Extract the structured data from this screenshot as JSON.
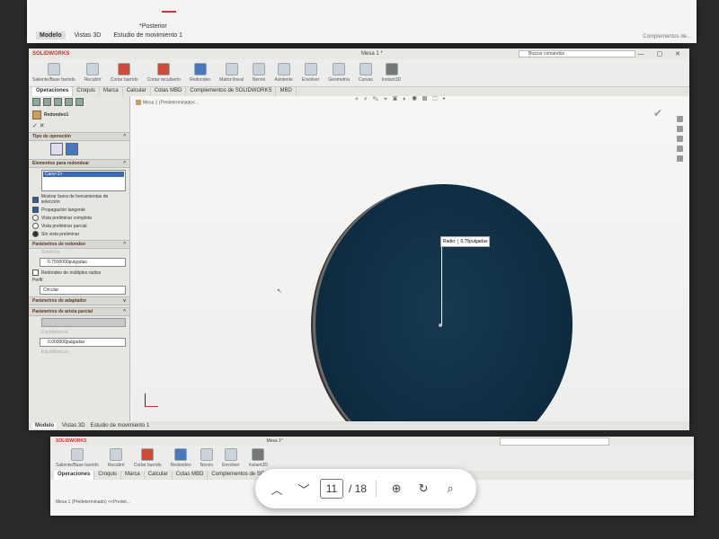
{
  "top_page": {
    "label": "*Posterior",
    "tabs": [
      "Modelo",
      "Vistas 3D",
      "Estudio de movimiento 1"
    ],
    "right_text": "Complementos de..."
  },
  "window": {
    "app": "SOLIDWORKS",
    "title": "Mesa 1 *",
    "search_placeholder": "Buscar comandos",
    "controls": "— ▢ ✕"
  },
  "ribbon": {
    "groups": [
      "Saliente/Base barrido",
      "Recubrir",
      "Cortar barrido",
      "Cortar recubierto",
      "Redondeo",
      "Matriz lineal",
      "Nervio",
      "Asistente",
      "Envolver",
      "Geometría",
      "Curvas",
      "Instant3D"
    ]
  },
  "tabs": [
    "Operaciones",
    "Croquis",
    "Marca",
    "Calcular",
    "Cotas MBD",
    "Complementos de SOLIDWORKS",
    "MBD"
  ],
  "property_manager": {
    "title": "Redondeo1",
    "sec_type": "Tipo de operación",
    "sec_items": "Elementos para redondear",
    "selected_item": "Cara<1>",
    "opt_toolbar": "Mostrar barra de herramientas de selección",
    "opt_tangent": "Propagación tangente",
    "opt_full": "Vista preliminar completa",
    "opt_partial": "Vista preliminar parcial",
    "opt_none": "Sin vista preliminar",
    "sec_params": "Parámetros de redondeo",
    "simetrico": "Simétrico",
    "radius_value": "0.7500000pulgadas",
    "multi_radius": "Redondeo de múltiples radios",
    "perfil_label": "Perfil:",
    "perfil_value": "Circular",
    "sec_setback": "Parámetros de adaptador",
    "sec_partial": "Parámetros de arista parcial",
    "distance_value": "0.000000pulgadas",
    "equidistancia": "Equidistancia"
  },
  "graphics": {
    "tree_item": "Mesa 1 (Predeterminado<...",
    "callout_label": "Radio:",
    "callout_value": "0.75pulgadas",
    "toolbar_glyphs": "⌕ ⌕ ✎ ⌖ ▣ ◐ ◉ ▤ ⬚ ▾"
  },
  "bottom_tabs": [
    "Modelo",
    "Vistas 3D",
    "Estudio de movimiento 1"
  ],
  "bottom_page": {
    "title": "Mesa 1*",
    "tree_item": "Mesa 1 (Predeterminado) <<Predet..."
  },
  "viewer": {
    "current_page": "11",
    "total_pages": "/ 18"
  }
}
